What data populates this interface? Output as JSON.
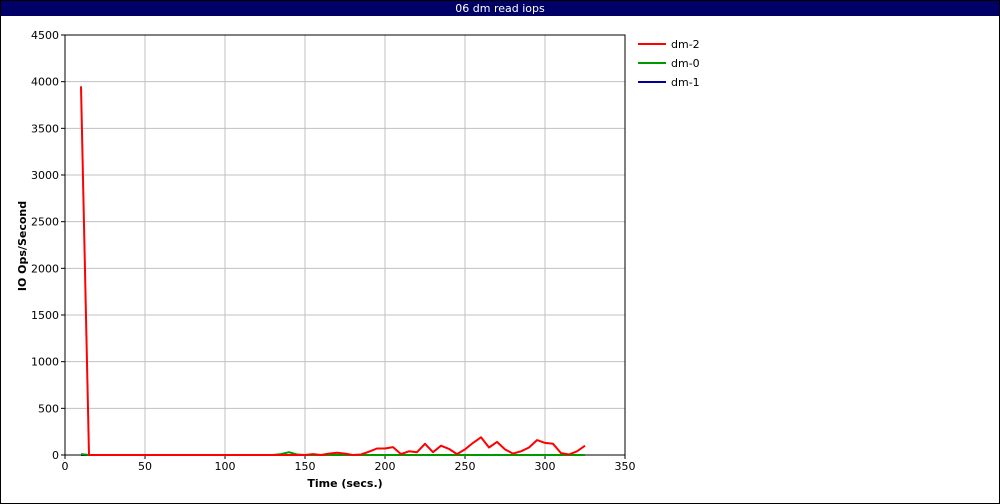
{
  "chart_data": {
    "type": "line",
    "title": "06 dm read iops",
    "xlabel": "Time (secs.)",
    "ylabel": "IO Ops/Second",
    "xlim": [
      0,
      350
    ],
    "ylim": [
      0,
      4500
    ],
    "xticks": [
      0,
      50,
      100,
      150,
      200,
      250,
      300,
      350
    ],
    "yticks": [
      0,
      500,
      1000,
      1500,
      2000,
      2500,
      3000,
      3500,
      4000,
      4500
    ],
    "grid": true,
    "legend_position": "right",
    "series": [
      {
        "name": "dm-2",
        "color": "#ff0000",
        "x": [
          10,
          15,
          20,
          25,
          30,
          35,
          40,
          45,
          50,
          55,
          60,
          65,
          70,
          75,
          80,
          85,
          90,
          95,
          100,
          105,
          110,
          115,
          120,
          125,
          130,
          135,
          140,
          145,
          150,
          155,
          160,
          165,
          170,
          175,
          180,
          185,
          190,
          195,
          200,
          205,
          210,
          215,
          220,
          225,
          230,
          235,
          240,
          245,
          250,
          255,
          260,
          265,
          270,
          275,
          280,
          285,
          290,
          295,
          300,
          305,
          310,
          315,
          320,
          325
        ],
        "y": [
          3950,
          0,
          0,
          0,
          0,
          0,
          0,
          0,
          0,
          0,
          0,
          0,
          0,
          0,
          0,
          0,
          0,
          0,
          0,
          0,
          0,
          0,
          0,
          0,
          0,
          0,
          0,
          0,
          0,
          10,
          0,
          15,
          25,
          15,
          0,
          5,
          35,
          70,
          70,
          85,
          10,
          40,
          30,
          120,
          30,
          100,
          65,
          10,
          60,
          130,
          190,
          80,
          140,
          60,
          15,
          40,
          80,
          160,
          130,
          120,
          20,
          5,
          40,
          100
        ]
      },
      {
        "name": "dm-0",
        "color": "#009900",
        "x": [
          10,
          15,
          20,
          40,
          60,
          80,
          100,
          120,
          130,
          135,
          140,
          145,
          150,
          160,
          180,
          200,
          220,
          240,
          260,
          280,
          300,
          320,
          325
        ],
        "y": [
          10,
          0,
          0,
          0,
          0,
          0,
          0,
          0,
          0,
          10,
          30,
          5,
          0,
          0,
          0,
          0,
          0,
          0,
          0,
          0,
          0,
          0,
          0
        ]
      },
      {
        "name": "dm-1",
        "color": "#000099",
        "x": [
          10,
          325
        ],
        "y": [
          0,
          0
        ]
      }
    ]
  }
}
